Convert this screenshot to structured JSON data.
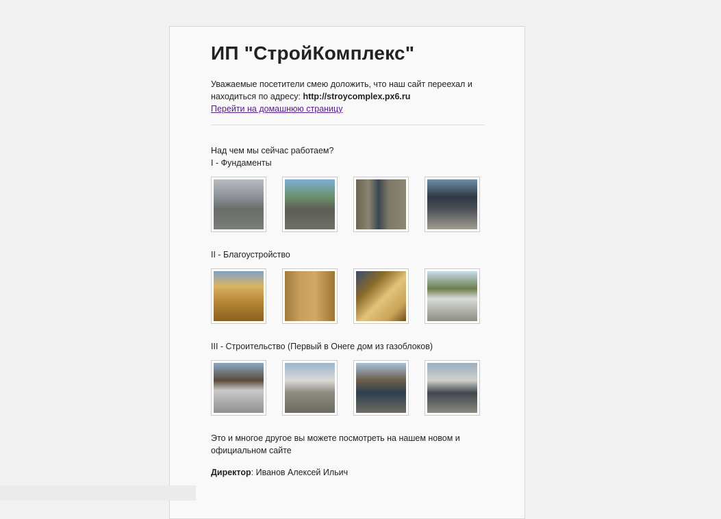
{
  "header": {
    "title": "ИП \"СтройКомплекс\""
  },
  "intro": {
    "text_before": "Уважаемые посетители смею доложить, что наш сайт переехал и находиться по адресу: ",
    "address": "http://stroycomplex.px6.ru",
    "home_link_label": "Перейти на домашнюю страницу"
  },
  "works": {
    "question": "Над чем мы сейчас работаем?",
    "sections": [
      {
        "title": "I - Фундаменты",
        "images": [
          "foundation-photo-1",
          "foundation-photo-2",
          "foundation-photo-3",
          "foundation-photo-4"
        ]
      },
      {
        "title": "II - Благоустройство",
        "images": [
          "landscaping-photo-1",
          "landscaping-photo-2",
          "landscaping-photo-3",
          "landscaping-photo-4"
        ]
      },
      {
        "title": "III - Строительство (Первый в Онеге дом из газоблоков)",
        "images": [
          "construction-photo-1",
          "construction-photo-2",
          "construction-photo-3",
          "construction-photo-4"
        ]
      }
    ]
  },
  "outro": {
    "text": "Это и многое другое вы можете посмотреть на нашем новом и официальном сайте"
  },
  "director": {
    "label": "Директор",
    "separator": ": ",
    "name": "Иванов Алексей Ильич"
  },
  "colors": {
    "page_background": "#f2f2f2",
    "card_background": "#f9f9f9",
    "text": "#222222",
    "visited_link": "#551a8b"
  }
}
